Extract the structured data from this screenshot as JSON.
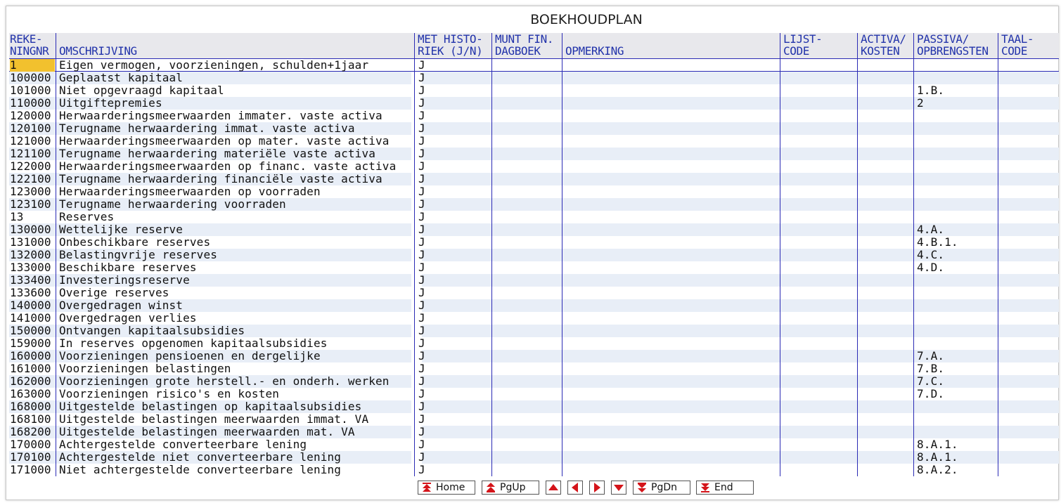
{
  "title": "BOEKHOUDPLAN",
  "columns": {
    "rekeningnr": [
      "REKE-",
      "NINGNR"
    ],
    "omschrijving": [
      "",
      "OMSCHRIJVING"
    ],
    "met_historiek": [
      "MET HISTO-",
      "RIEK (J/N)"
    ],
    "munt_fin": [
      "MUNT FIN.",
      "DAGBOEK"
    ],
    "opmerking": [
      "",
      "OPMERKING"
    ],
    "lijstcode": [
      "LIJST-",
      "CODE"
    ],
    "activa_kosten": [
      "ACTIVA/",
      "KOSTEN"
    ],
    "passiva_opbrengsten": [
      "PASSIVA/",
      "OPBRENGSTEN"
    ],
    "taalcode": [
      "TAAL-",
      "CODE"
    ]
  },
  "rows": [
    {
      "nr": "1",
      "desc": "Eigen vermogen, voorzieningen, schulden+1jaar",
      "hist": "J",
      "passiva": ""
    },
    {
      "nr": "100000",
      "desc": "Geplaatst kapitaal",
      "hist": "J",
      "passiva": ""
    },
    {
      "nr": "101000",
      "desc": "Niet opgevraagd kapitaal",
      "hist": "J",
      "passiva": "1.B."
    },
    {
      "nr": "110000",
      "desc": "Uitgiftepremies",
      "hist": "J",
      "passiva": "2"
    },
    {
      "nr": "120000",
      "desc": "Herwaarderingsmeerwaarden immater. vaste activa",
      "hist": "J",
      "passiva": ""
    },
    {
      "nr": "120100",
      "desc": "Terugname herwaardering immat. vaste activa",
      "hist": "J",
      "passiva": ""
    },
    {
      "nr": "121000",
      "desc": "Herwaarderingsmeerwaarden op mater. vaste activa",
      "hist": "J",
      "passiva": ""
    },
    {
      "nr": "121100",
      "desc": "Terugname herwaardering materiële vaste activa",
      "hist": "J",
      "passiva": ""
    },
    {
      "nr": "122000",
      "desc": "Herwaarderingsmeerwaarden op financ. vaste activa",
      "hist": "J",
      "passiva": ""
    },
    {
      "nr": "122100",
      "desc": "Terugname herwaardering financiële vaste activa",
      "hist": "J",
      "passiva": ""
    },
    {
      "nr": "123000",
      "desc": "Herwaarderingsmeerwaarden op voorraden",
      "hist": "J",
      "passiva": ""
    },
    {
      "nr": "123100",
      "desc": "Terugname herwaardering voorraden",
      "hist": "J",
      "passiva": ""
    },
    {
      "nr": "13",
      "desc": "Reserves",
      "hist": "J",
      "passiva": ""
    },
    {
      "nr": "130000",
      "desc": "Wettelijke reserve",
      "hist": "J",
      "passiva": "4.A."
    },
    {
      "nr": "131000",
      "desc": "Onbeschikbare reserves",
      "hist": "J",
      "passiva": "4.B.1."
    },
    {
      "nr": "132000",
      "desc": "Belastingvrije reserves",
      "hist": "J",
      "passiva": "4.C."
    },
    {
      "nr": "133000",
      "desc": "Beschikbare reserves",
      "hist": "J",
      "passiva": "4.D."
    },
    {
      "nr": "133400",
      "desc": "Investeringsreserve",
      "hist": "J",
      "passiva": ""
    },
    {
      "nr": "133600",
      "desc": "Overige reserves",
      "hist": "J",
      "passiva": ""
    },
    {
      "nr": "140000",
      "desc": "Overgedragen winst",
      "hist": "J",
      "passiva": ""
    },
    {
      "nr": "141000",
      "desc": "Overgedragen verlies",
      "hist": "J",
      "passiva": ""
    },
    {
      "nr": "150000",
      "desc": "Ontvangen kapitaalsubsidies",
      "hist": "J",
      "passiva": ""
    },
    {
      "nr": "159000",
      "desc": "In reserves opgenomen kapitaalsubsidies",
      "hist": "J",
      "passiva": ""
    },
    {
      "nr": "160000",
      "desc": "Voorzieningen pensioenen en dergelijke",
      "hist": "J",
      "passiva": "7.A."
    },
    {
      "nr": "161000",
      "desc": "Voorzieningen belastingen",
      "hist": "J",
      "passiva": "7.B."
    },
    {
      "nr": "162000",
      "desc": "Voorzieningen grote herstell.- en onderh. werken",
      "hist": "J",
      "passiva": "7.C."
    },
    {
      "nr": "163000",
      "desc": "Voorzieningen risico's en kosten",
      "hist": "J",
      "passiva": "7.D."
    },
    {
      "nr": "168000",
      "desc": "Uitgestelde belastingen op kapitaalsubsidies",
      "hist": "J",
      "passiva": ""
    },
    {
      "nr": "168100",
      "desc": "Uitgestelde belastingen meerwaarden immat. VA",
      "hist": "J",
      "passiva": ""
    },
    {
      "nr": "168200",
      "desc": "Uitgestelde belastingen meerwaarden mat. VA",
      "hist": "J",
      "passiva": ""
    },
    {
      "nr": "170000",
      "desc": "Achtergestelde converteerbare lening",
      "hist": "J",
      "passiva": "8.A.1."
    },
    {
      "nr": "170100",
      "desc": "Achtergestelde niet converteerbare lening",
      "hist": "J",
      "passiva": "8.A.1."
    },
    {
      "nr": "171000",
      "desc": "Niet achtergestelde converteerbare lening",
      "hist": "J",
      "passiva": "8.A.2."
    }
  ],
  "nav": {
    "home": "Home",
    "pgup": "PgUp",
    "pgdn": "PgDn",
    "end": "End"
  },
  "colors": {
    "header_text": "#2233aa",
    "grid_line": "#2b2bb5",
    "cursor": "#f2c12e",
    "alt_row": "#e8eef7"
  }
}
